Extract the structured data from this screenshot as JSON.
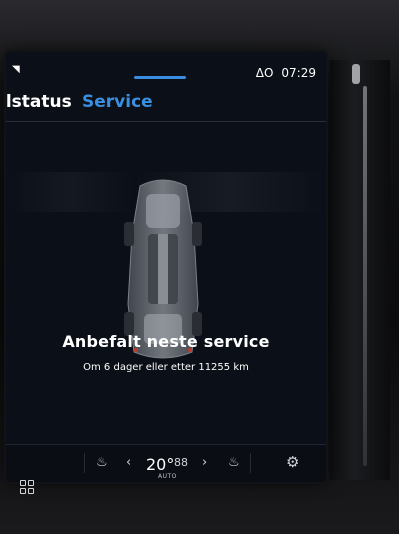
{
  "status_bar": {
    "time": "07:29",
    "connection_label": "ᐃO"
  },
  "tabs": [
    {
      "label": "ilstatus",
      "active": false
    },
    {
      "label": "Service",
      "active": true,
      "color": "#3b8fe0"
    }
  ],
  "service": {
    "title": "Anbefalt neste service",
    "subtitle": "Om 6 dager eller etter 11255 km"
  },
  "climate": {
    "temperature": "20°",
    "mode": "AUTO",
    "fan_label": "88"
  },
  "icons": {
    "home": "grid-icon",
    "seat_left": "seat-heat-icon",
    "seat_right": "seat-heat-icon",
    "settings": "gear-icon",
    "wifi": "wifi-icon"
  },
  "colors": {
    "accent": "#3b8fe0",
    "background": "#0b0f17"
  }
}
